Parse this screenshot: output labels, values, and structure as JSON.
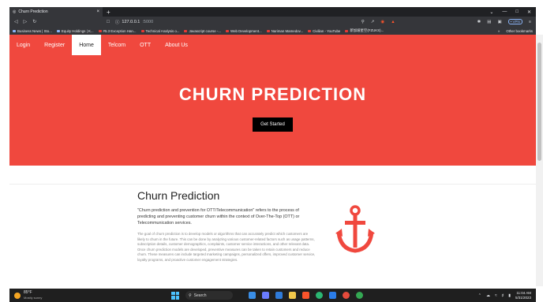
{
  "browser": {
    "tab_title": "Churn Prediction",
    "tab_close": "×",
    "new_tab": "+",
    "url_host": "127.0.0.1",
    "url_port": ":5000",
    "vpn_label": "• VPN",
    "window_controls": [
      "⌄",
      "—",
      "□",
      "✕"
    ],
    "bookmarks": [
      {
        "label": "Business News | Sto...",
        "color": "#8ab4f8"
      },
      {
        "label": "Equity Holdings | K...",
        "color": "#8ab4f8"
      },
      {
        "label": "#5.3 Exception Han...",
        "color": "#e53935"
      },
      {
        "label": "Technical Analysis o...",
        "color": "#e53935"
      },
      {
        "label": "Javascript course -...",
        "color": "#e53935"
      },
      {
        "label": "Web Development...",
        "color": "#e53935"
      },
      {
        "label": "Nariman Mamedov...",
        "color": "#e53935"
      },
      {
        "label": "Civilian - YouTube",
        "color": "#e53935"
      },
      {
        "label": "新加坡星空(FZUKS)...",
        "color": "#e53935"
      }
    ],
    "other_bookmarks": "Other bookmarks"
  },
  "site": {
    "nav": [
      {
        "label": "Login",
        "active": false
      },
      {
        "label": "Register",
        "active": false
      },
      {
        "label": "Home",
        "active": true
      },
      {
        "label": "Telcom",
        "active": false
      },
      {
        "label": "OTT",
        "active": false
      },
      {
        "label": "About Us",
        "active": false
      }
    ],
    "hero_title": "CHURN PREDICTION",
    "cta_label": "Get Started",
    "section_title": "Churn Prediction",
    "lead_text": "\"Churn prediction and prevention for OTT/Telecommunication\" refers to the process of predicting and preventing customer churn within the context of Over-The-Top (OTT) or Telecommunication services.",
    "body_text": "The goal of churn prediction is to develop models or algorithms that can accurately predict which customers are likely to churn in the future. This can be done by analyzing various customer-related factors such as usage patterns, subscription details, customer demographics, complaints, customer service interactions, and other relevant data. Once churn prediction models are developed, preventive measures can be taken to retain customers and reduce churn. These measures can include targeted marketing campaigns, personalized offers, improved customer service, loyalty programs, and proactive customer engagement strategies.",
    "accent_color": "#f0483e"
  },
  "taskbar": {
    "temperature": "85°F",
    "weather": "Mostly sunny",
    "search_label": "Search",
    "time": "11:04 AM",
    "date": "5/31/2023"
  }
}
